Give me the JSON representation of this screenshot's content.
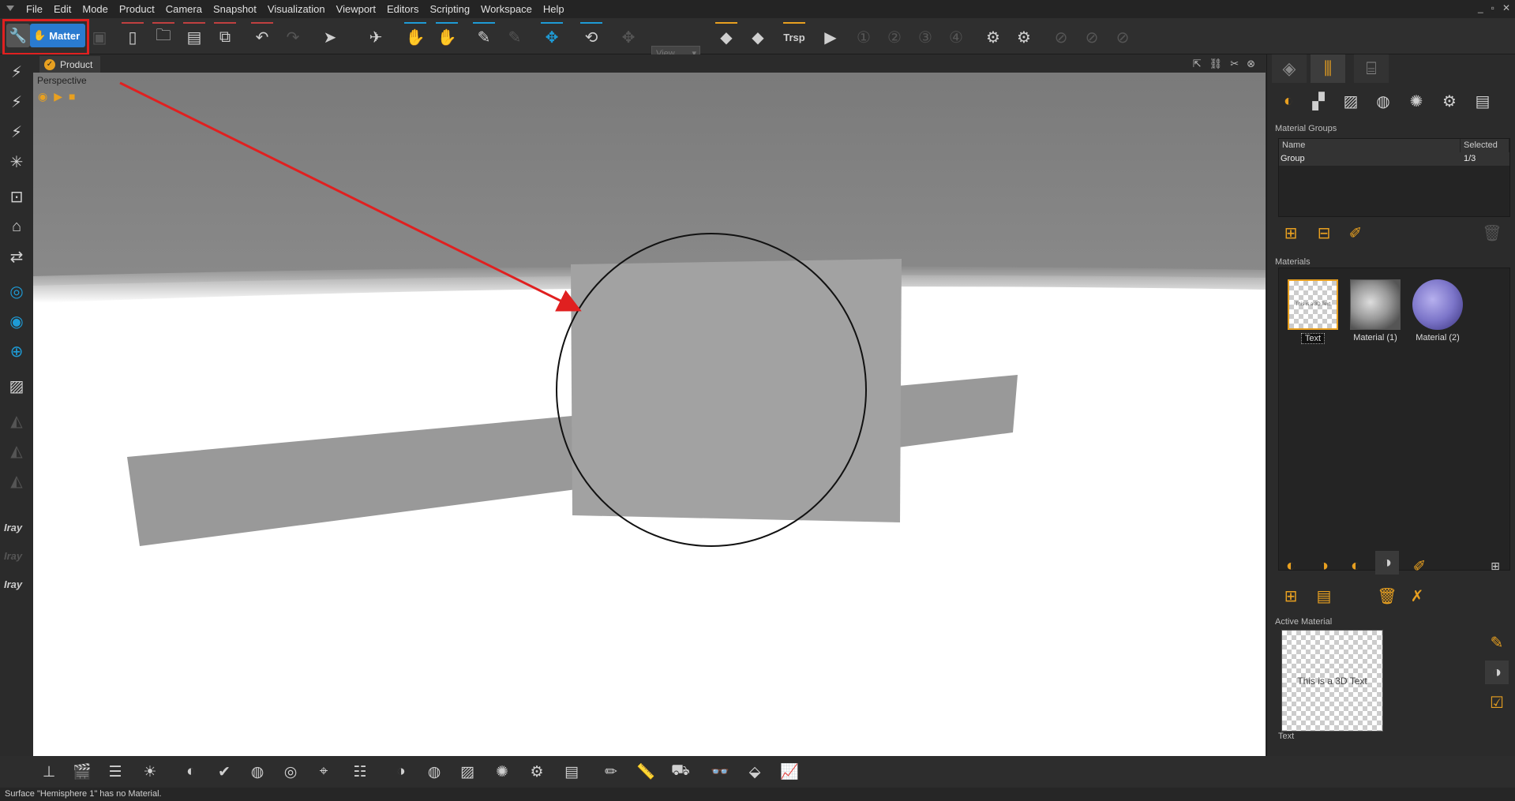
{
  "menubar": {
    "items": [
      "File",
      "Edit",
      "Mode",
      "Product",
      "Camera",
      "Snapshot",
      "Visualization",
      "Viewport",
      "Editors",
      "Scripting",
      "Workspace",
      "Help"
    ],
    "window_controls": [
      "_",
      "▫",
      "✕"
    ]
  },
  "toolbar": {
    "matter_label": "Matter",
    "view_select": "View",
    "trsp_label": "Trsp",
    "accent_color": "#2a7bd0",
    "highlight_color": "#e02020"
  },
  "left_toolbar": {
    "iray_labels": [
      "Iray",
      "Iray",
      "Iray"
    ]
  },
  "viewport": {
    "tab_label": "Product",
    "camera_label": "Perspective"
  },
  "right_panel": {
    "material_groups_title": "Material Groups",
    "table_headers": [
      "Name",
      "Selected"
    ],
    "table_rows": [
      {
        "name": "Group",
        "selected": "1/3"
      }
    ],
    "materials_title": "Materials",
    "materials": [
      {
        "label": "Text",
        "thumb_text": "This is a 3D Text"
      },
      {
        "label": "Material (1)"
      },
      {
        "label": "Material (2)"
      }
    ],
    "active_material_title": "Active Material",
    "active_material_preview": "This is a 3D Text",
    "active_material_name": "Text"
  },
  "status": {
    "text": "Surface \"Hemisphere 1\" has no Material."
  }
}
